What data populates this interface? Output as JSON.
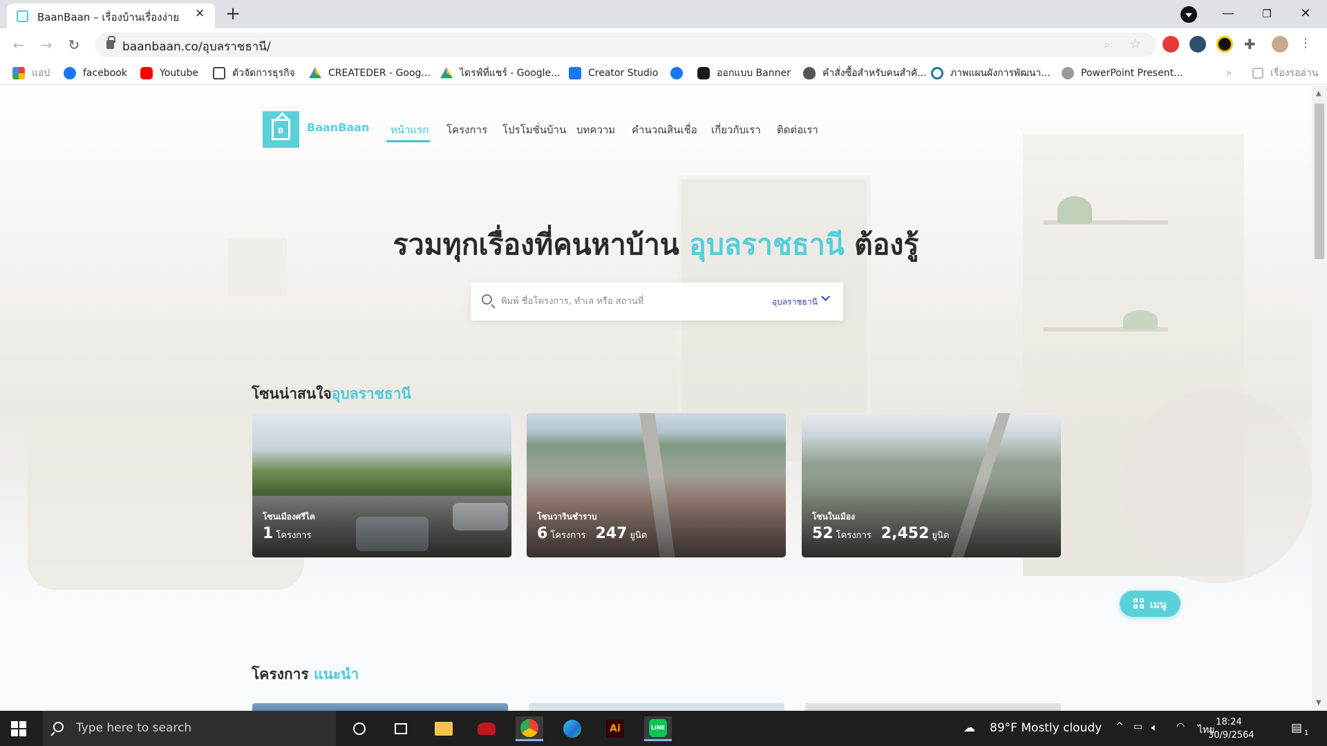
{
  "browser": {
    "tab_title": "BaanBaan – เรื่องบ้านเรื่องง่าย",
    "url": "baanbaan.co/อุบลราชธานี/"
  },
  "bookmarks": [
    {
      "label": "แอป",
      "icon": "apps-grid-icon",
      "color": "#e94235"
    },
    {
      "label": "facebook",
      "icon": "facebook-icon",
      "color": "#1877f2"
    },
    {
      "label": "Youtube",
      "icon": "youtube-icon",
      "color": "#ff0000"
    },
    {
      "label": "ตัวจัดการธุรกิจ",
      "icon": "business-manager-icon",
      "color": "#444444"
    },
    {
      "label": "CREATEDER - Goog...",
      "icon": "google-drive-icon",
      "color": "#1fa463"
    },
    {
      "label": "ไดรฟ์ที่แชร์ - Google...",
      "icon": "google-drive-icon",
      "color": "#1fa463"
    },
    {
      "label": "Creator Studio",
      "icon": "creator-studio-icon",
      "color": "#1877f2"
    },
    {
      "label": "",
      "icon": "facebook-icon",
      "color": "#1877f2"
    },
    {
      "label": "ออกแบบ Banner",
      "icon": "banner-design-icon",
      "color": "#1a1a1a"
    },
    {
      "label": "คำสั่งซื้อสำหรับคนสำคั...",
      "icon": "apple-icon",
      "color": "#555555"
    },
    {
      "label": "ภาพแผนผังการพัฒนา...",
      "icon": "wordpress-icon",
      "color": "#21759b"
    },
    {
      "label": "PowerPoint Present...",
      "icon": "globe-icon",
      "color": "#777777"
    }
  ],
  "reading_list": "เรื่องรออ่าน",
  "site": {
    "brand": "BaanBaan",
    "nav": [
      "หน้าแรก",
      "โครงการ",
      "โปรโมชั่นบ้าน",
      "บทความ",
      "คำนวณสินเชื่อ",
      "เกี่ยวกับเรา",
      "ติดต่อเรา"
    ],
    "active_nav": "หน้าแรก"
  },
  "hero": {
    "headline_before": "รวมทุกเรื่องที่คนหาบ้าน",
    "headline_highlight": "อุบลราชธานี",
    "headline_after": "ต้องรู้"
  },
  "search": {
    "placeholder": "พิมพ์ ชื่อโครงการ, ทำเล หรือ สถานที่",
    "province": "อุบลราชธานี"
  },
  "zones_section": {
    "title": "โซนน่าสนใจ",
    "title_highlight": "อุบลราชธานี"
  },
  "zones": [
    {
      "name": "โซนเมืองศรีไค",
      "projects": "1",
      "projects_label": "โครงการ",
      "units": "",
      "units_label": ""
    },
    {
      "name": "โซนวารินชำราบ",
      "projects": "6",
      "projects_label": "โครงการ",
      "units": "247",
      "units_label": "ยูนิต"
    },
    {
      "name": "โซนในเมือง",
      "projects": "52",
      "projects_label": "โครงการ",
      "units": "2,452",
      "units_label": "ยูนิต"
    }
  ],
  "menu_button": "เมนู",
  "projects_section": {
    "title": "โครงการ",
    "title_highlight": "แนะนำ"
  },
  "taskbar": {
    "search_placeholder": "Type here to search",
    "weather": "89°F  Mostly cloudy",
    "language": "ไทย",
    "time": "18:24",
    "date": "30/9/2564",
    "notification_count": "1"
  }
}
